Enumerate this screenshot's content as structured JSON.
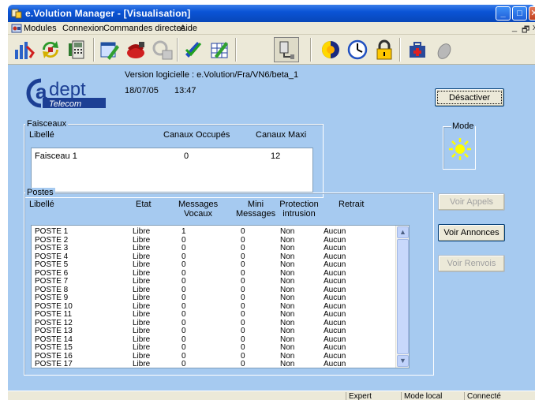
{
  "window": {
    "title": "e.Volution Manager - [Visualisation]",
    "controls": {
      "minimize": "_",
      "maximize": "□",
      "close": "✕"
    }
  },
  "menu": {
    "items": [
      "Modules",
      "Connexion",
      "Commandes directes",
      "Aide"
    ],
    "mdi_controls": [
      "_",
      "🗗",
      "x"
    ]
  },
  "toolbar": {
    "icons": [
      "bars-chart-icon",
      "refresh-arrows-icon",
      "phone-list-icon",
      "window-edit-icon",
      "red-phone-icon",
      "keypad-icon",
      "pen-check-icon",
      "grid-edit-icon",
      "network-plug-icon",
      "day-night-icon",
      "clock-icon",
      "padlock-icon",
      "medical-case-icon",
      "mouse-icon"
    ]
  },
  "header": {
    "logo_text": {
      "brand": "dept",
      "sub": "Telecom"
    },
    "version": "Version logicielle : e.Volution/Fra/VN6/beta_1",
    "date": "18/07/05",
    "time": "13:47"
  },
  "buttons": {
    "desactiver": "Désactiver",
    "voir_appels": "Voir Appels",
    "voir_annonces": "Voir Annonces",
    "voir_renvois": "Voir Renvois"
  },
  "mode": {
    "title": "Mode",
    "icon": "sun-icon"
  },
  "faisceaux": {
    "title": "Faisceaux",
    "columns": {
      "libelle": "Libellé",
      "occupes": "Canaux Occupés",
      "maxi": "Canaux Maxi"
    },
    "rows": [
      {
        "libelle": "Faisceau 1",
        "occupes": "0",
        "maxi": "12"
      }
    ]
  },
  "postes": {
    "title": "Postes",
    "columns": {
      "libelle": "Libellé",
      "etat": "Etat",
      "messages_vocaux": [
        "Messages",
        "Vocaux"
      ],
      "mini_messages": [
        "Mini",
        "Messages"
      ],
      "protection": [
        "Protection",
        "intrusion"
      ],
      "retrait": "Retrait"
    },
    "rows": [
      [
        "POSTE 1",
        "Libre",
        "1",
        "0",
        "Non",
        "Aucun"
      ],
      [
        "POSTE 2",
        "Libre",
        "0",
        "0",
        "Non",
        "Aucun"
      ],
      [
        "POSTE 3",
        "Libre",
        "0",
        "0",
        "Non",
        "Aucun"
      ],
      [
        "POSTE 4",
        "Libre",
        "0",
        "0",
        "Non",
        "Aucun"
      ],
      [
        "POSTE 5",
        "Libre",
        "0",
        "0",
        "Non",
        "Aucun"
      ],
      [
        "POSTE 6",
        "Libre",
        "0",
        "0",
        "Non",
        "Aucun"
      ],
      [
        "POSTE 7",
        "Libre",
        "0",
        "0",
        "Non",
        "Aucun"
      ],
      [
        "POSTE 8",
        "Libre",
        "0",
        "0",
        "Non",
        "Aucun"
      ],
      [
        "POSTE 9",
        "Libre",
        "0",
        "0",
        "Non",
        "Aucun"
      ],
      [
        "POSTE 10",
        "Libre",
        "0",
        "0",
        "Non",
        "Aucun"
      ],
      [
        "POSTE 11",
        "Libre",
        "0",
        "0",
        "Non",
        "Aucun"
      ],
      [
        "POSTE 12",
        "Libre",
        "0",
        "0",
        "Non",
        "Aucun"
      ],
      [
        "POSTE 13",
        "Libre",
        "0",
        "0",
        "Non",
        "Aucun"
      ],
      [
        "POSTE 14",
        "Libre",
        "0",
        "0",
        "Non",
        "Aucun"
      ],
      [
        "POSTE 15",
        "Libre",
        "0",
        "0",
        "Non",
        "Aucun"
      ],
      [
        "POSTE 16",
        "Libre",
        "0",
        "0",
        "Non",
        "Aucun"
      ],
      [
        "POSTE 17",
        "Libre",
        "0",
        "0",
        "Non",
        "Aucun"
      ]
    ]
  },
  "statusbar": {
    "panels": [
      "Expert",
      "Mode local",
      "Connecté"
    ]
  },
  "colors": {
    "client_bg": "#a6caf0",
    "titlebar": "#0a54d6",
    "logo_blue": "#1c3f94"
  }
}
